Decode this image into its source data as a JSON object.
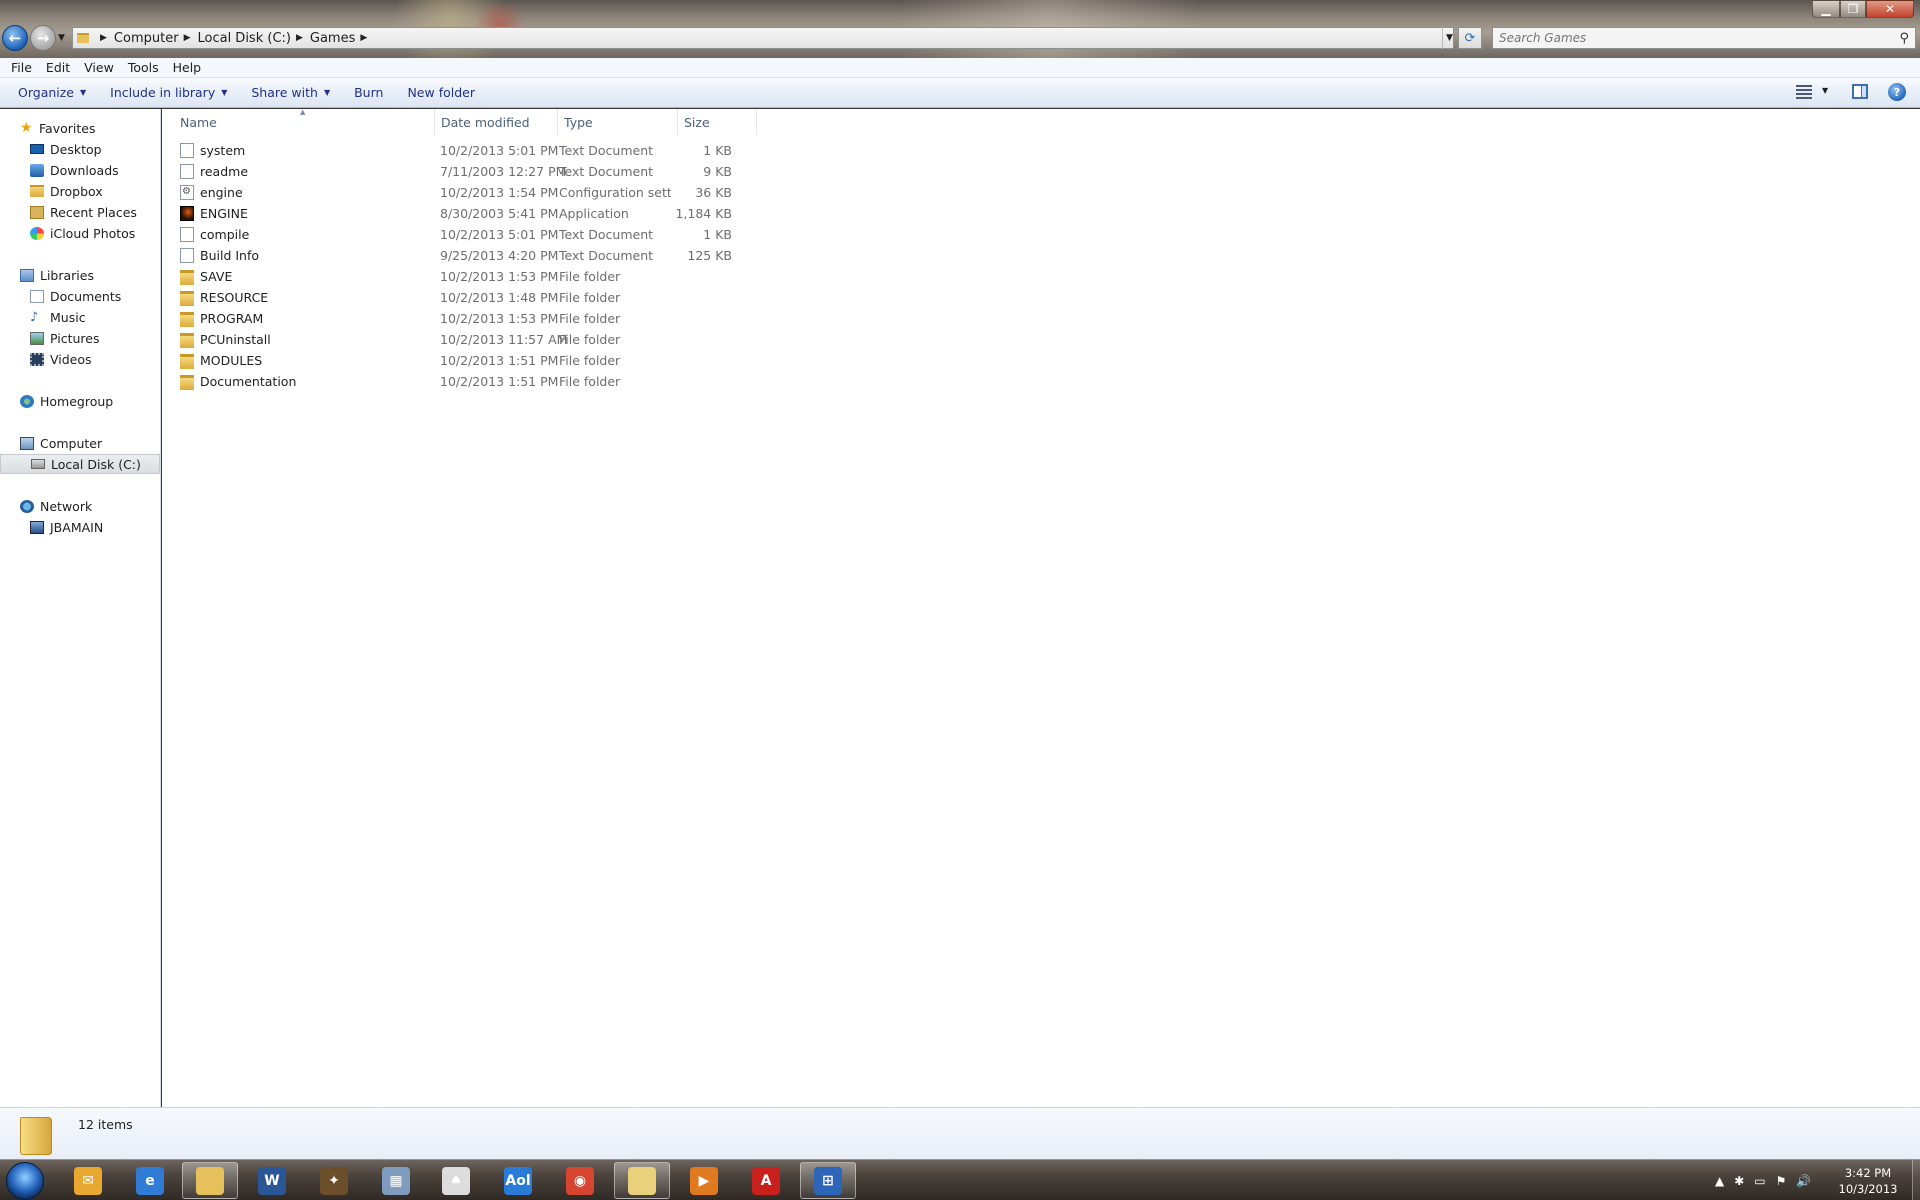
{
  "window": {
    "minimize_glyph": "▁",
    "maximize_glyph": "❐",
    "close_glyph": "✕"
  },
  "navigation": {
    "back_glyph": "←",
    "forward_glyph": "→",
    "history_dropdown_glyph": "▼",
    "breadcrumb": [
      "Computer",
      "Local Disk (C:)",
      "Games"
    ],
    "breadcrumb_separator": "▶",
    "address_dropdown_glyph": "▼",
    "refresh_glyph": "⟳",
    "search_placeholder": "Search Games",
    "search_glyph": "⚲"
  },
  "menubar": {
    "items": [
      "File",
      "Edit",
      "View",
      "Tools",
      "Help"
    ]
  },
  "commandbar": {
    "organize": "Organize",
    "include_in_library": "Include in library",
    "share_with": "Share with",
    "burn": "Burn",
    "new_folder": "New folder",
    "caret": "▼",
    "help_glyph": "?"
  },
  "navpane": {
    "favorites": {
      "label": "Favorites",
      "items": [
        "Desktop",
        "Downloads",
        "Dropbox",
        "Recent Places",
        "iCloud Photos"
      ]
    },
    "libraries": {
      "label": "Libraries",
      "items": [
        "Documents",
        "Music",
        "Pictures",
        "Videos"
      ]
    },
    "homegroup": {
      "label": "Homegroup"
    },
    "computer": {
      "label": "Computer",
      "items": [
        "Local Disk (C:)"
      ]
    },
    "network": {
      "label": "Network",
      "items": [
        "JBAMAIN"
      ]
    },
    "star_glyph": "★",
    "music_glyph": "♪"
  },
  "filelist": {
    "columns": {
      "name": "Name",
      "date": "Date modified",
      "type": "Type",
      "size": "Size"
    },
    "sort_glyph": "▲",
    "rows": [
      {
        "name": "system",
        "date": "10/2/2013 5:01 PM",
        "type": "Text Document",
        "size": "1 KB",
        "icon": "text-file-icon"
      },
      {
        "name": "readme",
        "date": "7/11/2003 12:27 PM",
        "type": "Text Document",
        "size": "9 KB",
        "icon": "text-file-icon"
      },
      {
        "name": "engine",
        "date": "10/2/2013 1:54 PM",
        "type": "Configuration sett...",
        "size": "36 KB",
        "icon": "config-file-icon"
      },
      {
        "name": "ENGINE",
        "date": "8/30/2003 5:41 PM",
        "type": "Application",
        "size": "1,184 KB",
        "icon": "application-icon"
      },
      {
        "name": "compile",
        "date": "10/2/2013 5:01 PM",
        "type": "Text Document",
        "size": "1 KB",
        "icon": "text-file-icon"
      },
      {
        "name": "Build Info",
        "date": "9/25/2013 4:20 PM",
        "type": "Text Document",
        "size": "125 KB",
        "icon": "text-file-icon"
      },
      {
        "name": "SAVE",
        "date": "10/2/2013 1:53 PM",
        "type": "File folder",
        "size": "",
        "icon": "folder-icon"
      },
      {
        "name": "RESOURCE",
        "date": "10/2/2013 1:48 PM",
        "type": "File folder",
        "size": "",
        "icon": "folder-icon"
      },
      {
        "name": "PROGRAM",
        "date": "10/2/2013 1:53 PM",
        "type": "File folder",
        "size": "",
        "icon": "folder-icon"
      },
      {
        "name": "PCUninstall",
        "date": "10/2/2013 11:57 AM",
        "type": "File folder",
        "size": "",
        "icon": "folder-icon"
      },
      {
        "name": "MODULES",
        "date": "10/2/2013 1:51 PM",
        "type": "File folder",
        "size": "",
        "icon": "folder-icon"
      },
      {
        "name": "Documentation",
        "date": "10/2/2013 1:51 PM",
        "type": "File folder",
        "size": "",
        "icon": "folder-icon"
      }
    ]
  },
  "details": {
    "items_count": "12 items"
  },
  "taskbar": {
    "apps": [
      {
        "name": "outlook",
        "glyph": "✉",
        "color": "#e8a830"
      },
      {
        "name": "internet-explorer",
        "glyph": "e",
        "color": "#2f7bd6"
      },
      {
        "name": "windows-explorer",
        "glyph": "",
        "color": "#e6c05a",
        "active": true
      },
      {
        "name": "word",
        "glyph": "W",
        "color": "#2b5797"
      },
      {
        "name": "game",
        "glyph": "✦",
        "color": "#6b4e2a"
      },
      {
        "name": "calculator",
        "glyph": "▦",
        "color": "#7f9bbd"
      },
      {
        "name": "solitaire",
        "glyph": "♠",
        "color": "#dddddd"
      },
      {
        "name": "aol",
        "glyph": "Aol",
        "color": "#2a7bd8"
      },
      {
        "name": "chrome",
        "glyph": "◉",
        "color": "#d6452f"
      },
      {
        "name": "folder",
        "glyph": "",
        "color": "#e9d07a",
        "active": true
      },
      {
        "name": "media-player",
        "glyph": "▶",
        "color": "#e07a20"
      },
      {
        "name": "acrobat",
        "glyph": "A",
        "color": "#c8201c"
      },
      {
        "name": "remote-desktop",
        "glyph": "⊞",
        "color": "#2d66b8",
        "active": true
      }
    ],
    "tray_glyphs": [
      "▲",
      "✱",
      "▭",
      "⚑",
      "🔊"
    ],
    "time": "3:42 PM",
    "date": "10/3/2013"
  },
  "colors": {
    "accent": "#1e3287",
    "selection": "#d9dde1",
    "details_bg": "#e8eef7"
  }
}
